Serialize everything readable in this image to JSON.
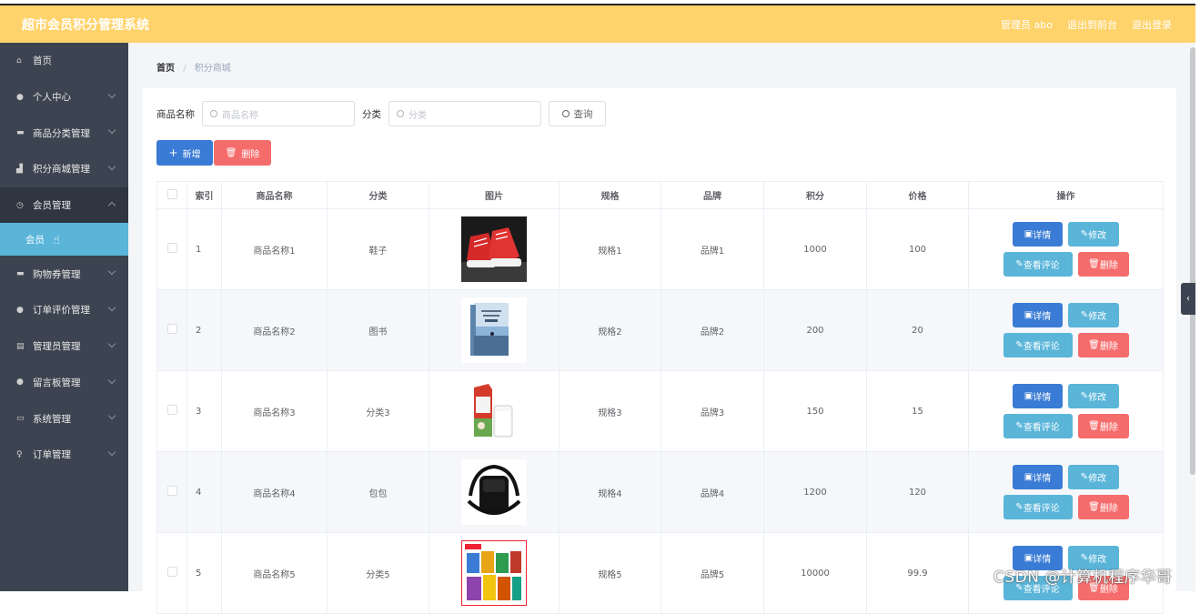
{
  "header": {
    "app_title": "超市会员积分管理系统",
    "user_label": "管理员 abo",
    "front_link": "退出到前台",
    "logout_link": "退出登录"
  },
  "sidebar": {
    "items": [
      {
        "label": "首页",
        "icon": "home-icon",
        "chevron": false
      },
      {
        "label": "个人中心",
        "icon": "user-icon",
        "chevron": true
      },
      {
        "label": "商品分类管理",
        "icon": "list-icon",
        "chevron": true
      },
      {
        "label": "积分商城管理",
        "icon": "chart-icon",
        "chevron": true
      },
      {
        "label": "会员管理",
        "icon": "clock-icon",
        "chevron": true,
        "open": true
      },
      {
        "label": "会员",
        "sub": true
      },
      {
        "label": "购物券管理",
        "icon": "list-icon",
        "chevron": true
      },
      {
        "label": "订单评价管理",
        "icon": "user-icon",
        "chevron": true
      },
      {
        "label": "管理员管理",
        "icon": "doc-icon",
        "chevron": true
      },
      {
        "label": "留言板管理",
        "icon": "user-icon",
        "chevron": true
      },
      {
        "label": "系统管理",
        "icon": "screen-icon",
        "chevron": true
      },
      {
        "label": "订单管理",
        "icon": "bulb-icon",
        "chevron": true
      }
    ]
  },
  "breadcrumb": {
    "home": "首页",
    "sep": "/",
    "current": "积分商城"
  },
  "search": {
    "name_label": "商品名称",
    "name_placeholder": "商品名称",
    "category_label": "分类",
    "category_placeholder": "分类",
    "query_button": "查询"
  },
  "actions": {
    "add": "新增",
    "delete": "删除"
  },
  "table": {
    "headers": [
      "",
      "索引",
      "商品名称",
      "分类",
      "图片",
      "规格",
      "品牌",
      "积分",
      "价格",
      "操作"
    ],
    "rows": [
      {
        "index": "1",
        "name": "商品名称1",
        "category": "鞋子",
        "spec": "规格1",
        "brand": "品牌1",
        "points": "1000",
        "price": "100",
        "image": "red-sneakers"
      },
      {
        "index": "2",
        "name": "商品名称2",
        "category": "图书",
        "spec": "规格2",
        "brand": "品牌2",
        "points": "200",
        "price": "20",
        "image": "book"
      },
      {
        "index": "3",
        "name": "商品名称3",
        "category": "分类3",
        "spec": "规格3",
        "brand": "品牌3",
        "points": "150",
        "price": "15",
        "image": "milk"
      },
      {
        "index": "4",
        "name": "商品名称4",
        "category": "包包",
        "spec": "规格4",
        "brand": "品牌4",
        "points": "1200",
        "price": "120",
        "image": "black-bag"
      },
      {
        "index": "5",
        "name": "商品名称5",
        "category": "分类5",
        "spec": "规格5",
        "brand": "品牌5",
        "points": "10000",
        "price": "99.9",
        "image": "snacks"
      }
    ],
    "ops": {
      "detail": "详情",
      "edit": "修改",
      "review": "查看评论",
      "remove": "删除"
    }
  },
  "watermark": "CSDN @计算机程序华哥"
}
